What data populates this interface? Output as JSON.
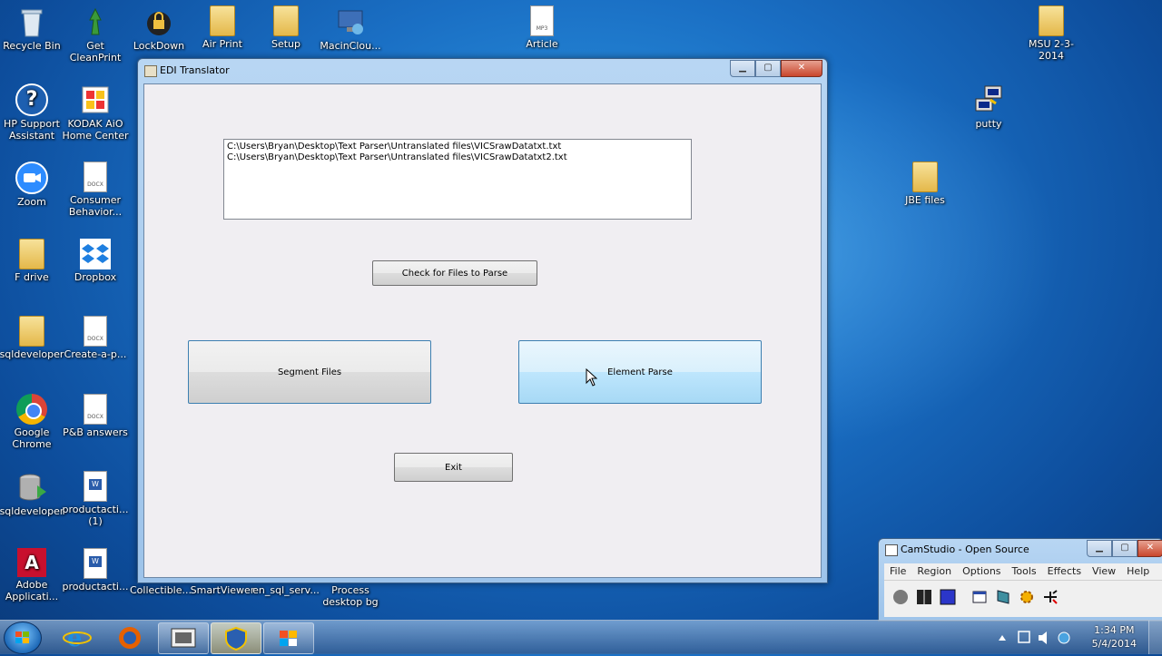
{
  "desktop": {
    "icons": [
      {
        "label": "Recycle Bin"
      },
      {
        "label": "Get CleanPrint"
      },
      {
        "label": "LockDown"
      },
      {
        "label": "Air Print"
      },
      {
        "label": "Setup"
      },
      {
        "label": "MacinClou..."
      },
      {
        "label": "Article"
      },
      {
        "label": "MSU 2-3-2014"
      },
      {
        "label": "HP Support Assistant"
      },
      {
        "label": "KODAK AiO Home Center"
      },
      {
        "label": "putty"
      },
      {
        "label": "Zoom"
      },
      {
        "label": "Consumer Behavior..."
      },
      {
        "label": "JBE files"
      },
      {
        "label": "F drive"
      },
      {
        "label": "Dropbox"
      },
      {
        "label": "sqldeveloper"
      },
      {
        "label": "Create-a-p..."
      },
      {
        "label": "Google Chrome"
      },
      {
        "label": "P&B answers"
      },
      {
        "label": "sqldeveloper"
      },
      {
        "label": "productacti... (1)"
      },
      {
        "label": "Adobe Applicati..."
      },
      {
        "label": "productacti..."
      },
      {
        "label": "Collectible..."
      },
      {
        "label": "SmartViewer"
      },
      {
        "label": "en_sql_serv..."
      },
      {
        "label": "Process desktop bg"
      }
    ]
  },
  "window": {
    "title": "EDI Translator",
    "minimize": "▁",
    "maximize": "▢",
    "close": "✕",
    "files": [
      "C:\\Users\\Bryan\\Desktop\\Text Parser\\Untranslated files\\VICSrawDatatxt.txt",
      "C:\\Users\\Bryan\\Desktop\\Text Parser\\Untranslated files\\VICSrawDatatxt2.txt"
    ],
    "check_button": "Check for Files to Parse",
    "segment_button": "Segment Files",
    "element_button": "Element Parse",
    "exit_button": "Exit"
  },
  "camstudio": {
    "title": "CamStudio - Open Source",
    "menu": [
      "File",
      "Region",
      "Options",
      "Tools",
      "Effects",
      "View",
      "Help"
    ]
  },
  "taskbar": {
    "time": "1:34 PM",
    "date": "5/4/2014"
  }
}
